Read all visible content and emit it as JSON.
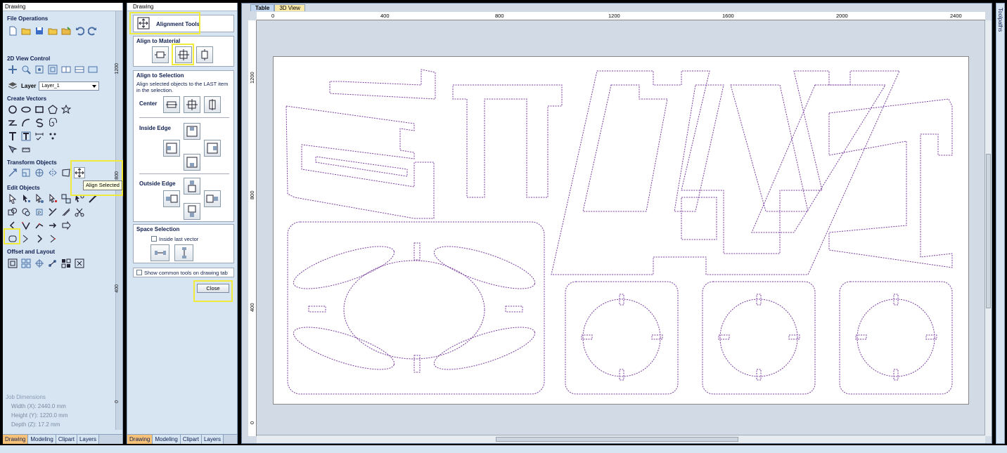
{
  "left_panel": {
    "title": "Drawing",
    "sections": {
      "file": "File Operations",
      "view": "2D View Control",
      "create": "Create Vectors",
      "transform": "Transform Objects",
      "edit": "Edit Objects",
      "offset": "Offset and Layout"
    },
    "layer_label": "Layer",
    "layer_value": "Layer_1",
    "tooltip": "Align Selected",
    "job_dimensions": {
      "title": "Job Dimensions",
      "width": "Width  (X): 2440.0 mm",
      "height": "Height (Y): 1220.0 mm",
      "depth": "Depth  (Z): 17.2 mm"
    },
    "side_ruler": [
      "1200",
      "800",
      "400",
      "0"
    ],
    "tabs": [
      "Drawing",
      "Modeling",
      "Clipart",
      "Layers"
    ]
  },
  "align_panel": {
    "title": "Drawing",
    "header": "Alignment Tools",
    "align_material": "Align to Material",
    "align_selection": "Align to Selection",
    "align_selection_desc": "Align selected objects to the LAST item in the selection.",
    "center": "Center",
    "inside_edge": "Inside Edge",
    "outside_edge": "Outside Edge",
    "space_selection": "Space Selection",
    "inside_last_vector": "Inside last vector",
    "show_common": "Show common tools on drawing tab",
    "close": "Close",
    "tabs": [
      "Drawing",
      "Modeling",
      "Clipart",
      "Layers"
    ]
  },
  "canvas": {
    "view_tabs": [
      "Table",
      "3D View"
    ],
    "hruler_labels": [
      "0",
      "400",
      "800",
      "1200",
      "1600",
      "2000",
      "2400"
    ],
    "vruler_labels": [
      "1200",
      "800",
      "400",
      "0"
    ]
  },
  "right_strip": {
    "label": "Toolpaths"
  },
  "colors": {
    "highlight": "#f0ea3a",
    "vector": "#7a3ea0",
    "panel": "#d7e4f2"
  }
}
